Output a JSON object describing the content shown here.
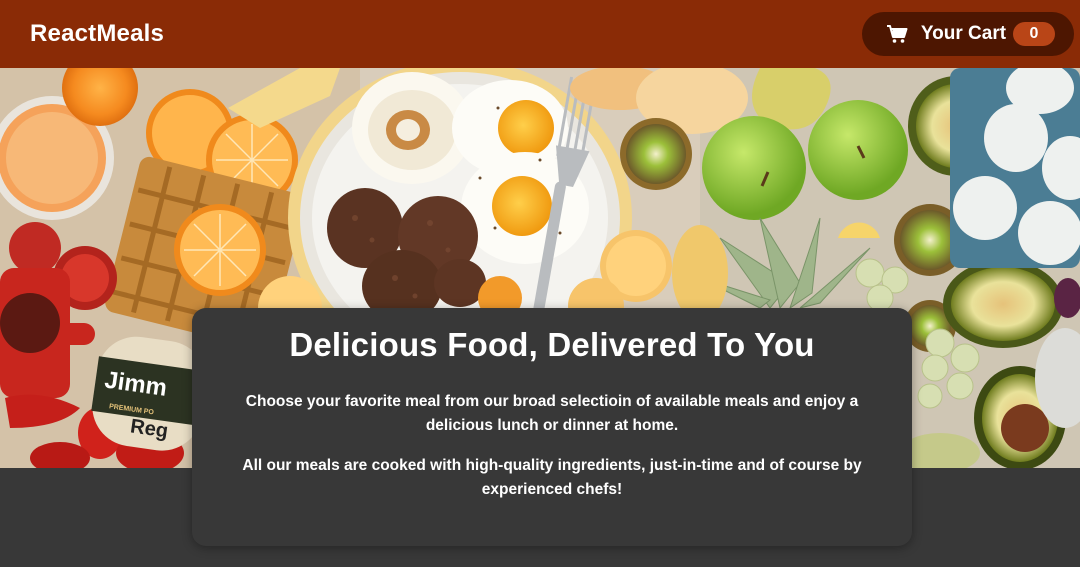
{
  "header": {
    "brand": "ReactMeals",
    "cart": {
      "icon": "shopping-cart-icon",
      "label": "Your Cart",
      "count": "0"
    }
  },
  "hero": {
    "image": "breakfast-table-photo",
    "package_text_1": "Jimm",
    "package_text_2": "PREMIUM PO",
    "package_text_3": "Reg"
  },
  "summary": {
    "title": "Delicious Food, Delivered To You",
    "paragraph_1": "Choose your favorite meal from our broad selectioin of available meals and enjoy a delicious lunch or dinner at home.",
    "paragraph_2": "All our meals are cooked with high-quality ingredients, just-in-time and of course by experienced chefs!"
  },
  "colors": {
    "header_bg": "#8a2b06",
    "cart_bg": "#4d1601",
    "badge_bg": "#b94517",
    "page_bg": "#383838"
  }
}
